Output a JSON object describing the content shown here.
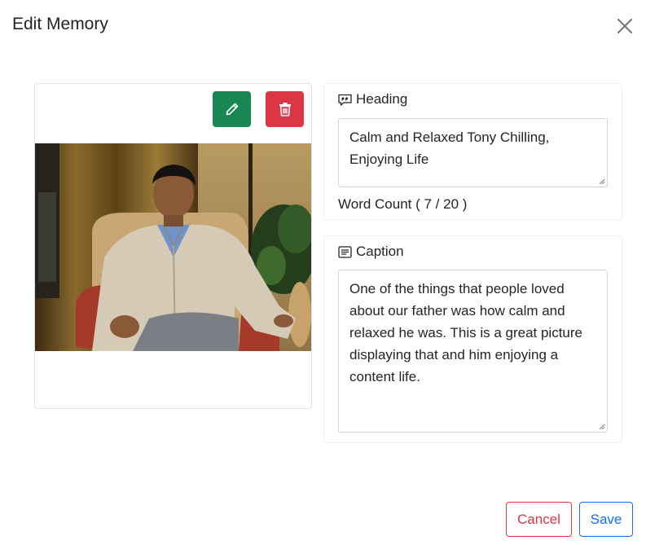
{
  "modal": {
    "title": "Edit Memory",
    "close_icon": "close-icon"
  },
  "photo_card": {
    "edit_icon": "pencil-icon",
    "delete_icon": "trash-icon",
    "edit_color": "#198754",
    "delete_color": "#dc3545"
  },
  "heading": {
    "label": "Heading",
    "icon": "quote-icon",
    "value": "Calm and Relaxed Tony Chilling, Enjoying Life",
    "word_count": "Word Count ( 7 / 20 )"
  },
  "caption": {
    "label": "Caption",
    "icon": "text-lines-icon",
    "value": "One of the things that people loved about our father was how calm and relaxed he was. This is a great picture displaying that and him enjoying a content life."
  },
  "footer": {
    "cancel_label": "Cancel",
    "save_label": "Save",
    "cancel_color": "#dc3545",
    "save_color": "#0d6efd"
  }
}
